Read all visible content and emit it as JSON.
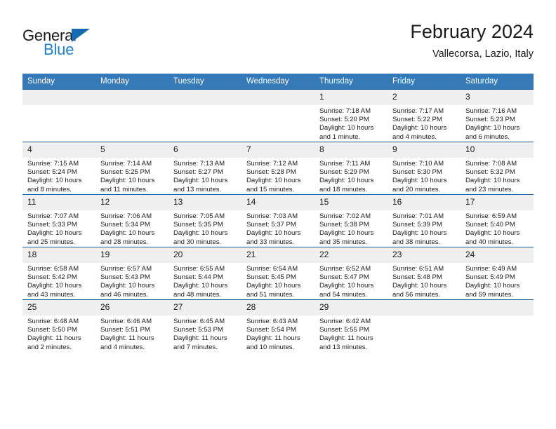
{
  "brand": {
    "name_top": "General",
    "name_bottom": "Blue",
    "triangle_color": "#1769b4",
    "blue_color": "#1b7fd4"
  },
  "header": {
    "title": "February 2024",
    "location": "Vallecorsa, Lazio, Italy"
  },
  "theme": {
    "header_bg": "#3579b8",
    "row_line": "#1b5f9e",
    "daynum_bg": "#efefef",
    "cell_bg": "#ffffff",
    "text": "#1a1a1a"
  },
  "calendar": {
    "weekday_headers": [
      "Sunday",
      "Monday",
      "Tuesday",
      "Wednesday",
      "Thursday",
      "Friday",
      "Saturday"
    ],
    "weeks": [
      [
        {
          "day": "",
          "sunrise": "",
          "sunset": "",
          "daylight_1": "",
          "daylight_2": "",
          "empty": true
        },
        {
          "day": "",
          "sunrise": "",
          "sunset": "",
          "daylight_1": "",
          "daylight_2": "",
          "empty": true
        },
        {
          "day": "",
          "sunrise": "",
          "sunset": "",
          "daylight_1": "",
          "daylight_2": "",
          "empty": true
        },
        {
          "day": "",
          "sunrise": "",
          "sunset": "",
          "daylight_1": "",
          "daylight_2": "",
          "empty": true
        },
        {
          "day": "1",
          "sunrise": "Sunrise: 7:18 AM",
          "sunset": "Sunset: 5:20 PM",
          "daylight_1": "Daylight: 10 hours",
          "daylight_2": "and 1 minute.",
          "empty": false
        },
        {
          "day": "2",
          "sunrise": "Sunrise: 7:17 AM",
          "sunset": "Sunset: 5:22 PM",
          "daylight_1": "Daylight: 10 hours",
          "daylight_2": "and 4 minutes.",
          "empty": false
        },
        {
          "day": "3",
          "sunrise": "Sunrise: 7:16 AM",
          "sunset": "Sunset: 5:23 PM",
          "daylight_1": "Daylight: 10 hours",
          "daylight_2": "and 6 minutes.",
          "empty": false
        }
      ],
      [
        {
          "day": "4",
          "sunrise": "Sunrise: 7:15 AM",
          "sunset": "Sunset: 5:24 PM",
          "daylight_1": "Daylight: 10 hours",
          "daylight_2": "and 8 minutes.",
          "empty": false
        },
        {
          "day": "5",
          "sunrise": "Sunrise: 7:14 AM",
          "sunset": "Sunset: 5:25 PM",
          "daylight_1": "Daylight: 10 hours",
          "daylight_2": "and 11 minutes.",
          "empty": false
        },
        {
          "day": "6",
          "sunrise": "Sunrise: 7:13 AM",
          "sunset": "Sunset: 5:27 PM",
          "daylight_1": "Daylight: 10 hours",
          "daylight_2": "and 13 minutes.",
          "empty": false
        },
        {
          "day": "7",
          "sunrise": "Sunrise: 7:12 AM",
          "sunset": "Sunset: 5:28 PM",
          "daylight_1": "Daylight: 10 hours",
          "daylight_2": "and 15 minutes.",
          "empty": false
        },
        {
          "day": "8",
          "sunrise": "Sunrise: 7:11 AM",
          "sunset": "Sunset: 5:29 PM",
          "daylight_1": "Daylight: 10 hours",
          "daylight_2": "and 18 minutes.",
          "empty": false
        },
        {
          "day": "9",
          "sunrise": "Sunrise: 7:10 AM",
          "sunset": "Sunset: 5:30 PM",
          "daylight_1": "Daylight: 10 hours",
          "daylight_2": "and 20 minutes.",
          "empty": false
        },
        {
          "day": "10",
          "sunrise": "Sunrise: 7:08 AM",
          "sunset": "Sunset: 5:32 PM",
          "daylight_1": "Daylight: 10 hours",
          "daylight_2": "and 23 minutes.",
          "empty": false
        }
      ],
      [
        {
          "day": "11",
          "sunrise": "Sunrise: 7:07 AM",
          "sunset": "Sunset: 5:33 PM",
          "daylight_1": "Daylight: 10 hours",
          "daylight_2": "and 25 minutes.",
          "empty": false
        },
        {
          "day": "12",
          "sunrise": "Sunrise: 7:06 AM",
          "sunset": "Sunset: 5:34 PM",
          "daylight_1": "Daylight: 10 hours",
          "daylight_2": "and 28 minutes.",
          "empty": false
        },
        {
          "day": "13",
          "sunrise": "Sunrise: 7:05 AM",
          "sunset": "Sunset: 5:35 PM",
          "daylight_1": "Daylight: 10 hours",
          "daylight_2": "and 30 minutes.",
          "empty": false
        },
        {
          "day": "14",
          "sunrise": "Sunrise: 7:03 AM",
          "sunset": "Sunset: 5:37 PM",
          "daylight_1": "Daylight: 10 hours",
          "daylight_2": "and 33 minutes.",
          "empty": false
        },
        {
          "day": "15",
          "sunrise": "Sunrise: 7:02 AM",
          "sunset": "Sunset: 5:38 PM",
          "daylight_1": "Daylight: 10 hours",
          "daylight_2": "and 35 minutes.",
          "empty": false
        },
        {
          "day": "16",
          "sunrise": "Sunrise: 7:01 AM",
          "sunset": "Sunset: 5:39 PM",
          "daylight_1": "Daylight: 10 hours",
          "daylight_2": "and 38 minutes.",
          "empty": false
        },
        {
          "day": "17",
          "sunrise": "Sunrise: 6:59 AM",
          "sunset": "Sunset: 5:40 PM",
          "daylight_1": "Daylight: 10 hours",
          "daylight_2": "and 40 minutes.",
          "empty": false
        }
      ],
      [
        {
          "day": "18",
          "sunrise": "Sunrise: 6:58 AM",
          "sunset": "Sunset: 5:42 PM",
          "daylight_1": "Daylight: 10 hours",
          "daylight_2": "and 43 minutes.",
          "empty": false
        },
        {
          "day": "19",
          "sunrise": "Sunrise: 6:57 AM",
          "sunset": "Sunset: 5:43 PM",
          "daylight_1": "Daylight: 10 hours",
          "daylight_2": "and 46 minutes.",
          "empty": false
        },
        {
          "day": "20",
          "sunrise": "Sunrise: 6:55 AM",
          "sunset": "Sunset: 5:44 PM",
          "daylight_1": "Daylight: 10 hours",
          "daylight_2": "and 48 minutes.",
          "empty": false
        },
        {
          "day": "21",
          "sunrise": "Sunrise: 6:54 AM",
          "sunset": "Sunset: 5:45 PM",
          "daylight_1": "Daylight: 10 hours",
          "daylight_2": "and 51 minutes.",
          "empty": false
        },
        {
          "day": "22",
          "sunrise": "Sunrise: 6:52 AM",
          "sunset": "Sunset: 5:47 PM",
          "daylight_1": "Daylight: 10 hours",
          "daylight_2": "and 54 minutes.",
          "empty": false
        },
        {
          "day": "23",
          "sunrise": "Sunrise: 6:51 AM",
          "sunset": "Sunset: 5:48 PM",
          "daylight_1": "Daylight: 10 hours",
          "daylight_2": "and 56 minutes.",
          "empty": false
        },
        {
          "day": "24",
          "sunrise": "Sunrise: 6:49 AM",
          "sunset": "Sunset: 5:49 PM",
          "daylight_1": "Daylight: 10 hours",
          "daylight_2": "and 59 minutes.",
          "empty": false
        }
      ],
      [
        {
          "day": "25",
          "sunrise": "Sunrise: 6:48 AM",
          "sunset": "Sunset: 5:50 PM",
          "daylight_1": "Daylight: 11 hours",
          "daylight_2": "and 2 minutes.",
          "empty": false
        },
        {
          "day": "26",
          "sunrise": "Sunrise: 6:46 AM",
          "sunset": "Sunset: 5:51 PM",
          "daylight_1": "Daylight: 11 hours",
          "daylight_2": "and 4 minutes.",
          "empty": false
        },
        {
          "day": "27",
          "sunrise": "Sunrise: 6:45 AM",
          "sunset": "Sunset: 5:53 PM",
          "daylight_1": "Daylight: 11 hours",
          "daylight_2": "and 7 minutes.",
          "empty": false
        },
        {
          "day": "28",
          "sunrise": "Sunrise: 6:43 AM",
          "sunset": "Sunset: 5:54 PM",
          "daylight_1": "Daylight: 11 hours",
          "daylight_2": "and 10 minutes.",
          "empty": false
        },
        {
          "day": "29",
          "sunrise": "Sunrise: 6:42 AM",
          "sunset": "Sunset: 5:55 PM",
          "daylight_1": "Daylight: 11 hours",
          "daylight_2": "and 13 minutes.",
          "empty": false
        },
        {
          "day": "",
          "sunrise": "",
          "sunset": "",
          "daylight_1": "",
          "daylight_2": "",
          "empty": true
        },
        {
          "day": "",
          "sunrise": "",
          "sunset": "",
          "daylight_1": "",
          "daylight_2": "",
          "empty": true
        }
      ]
    ]
  }
}
